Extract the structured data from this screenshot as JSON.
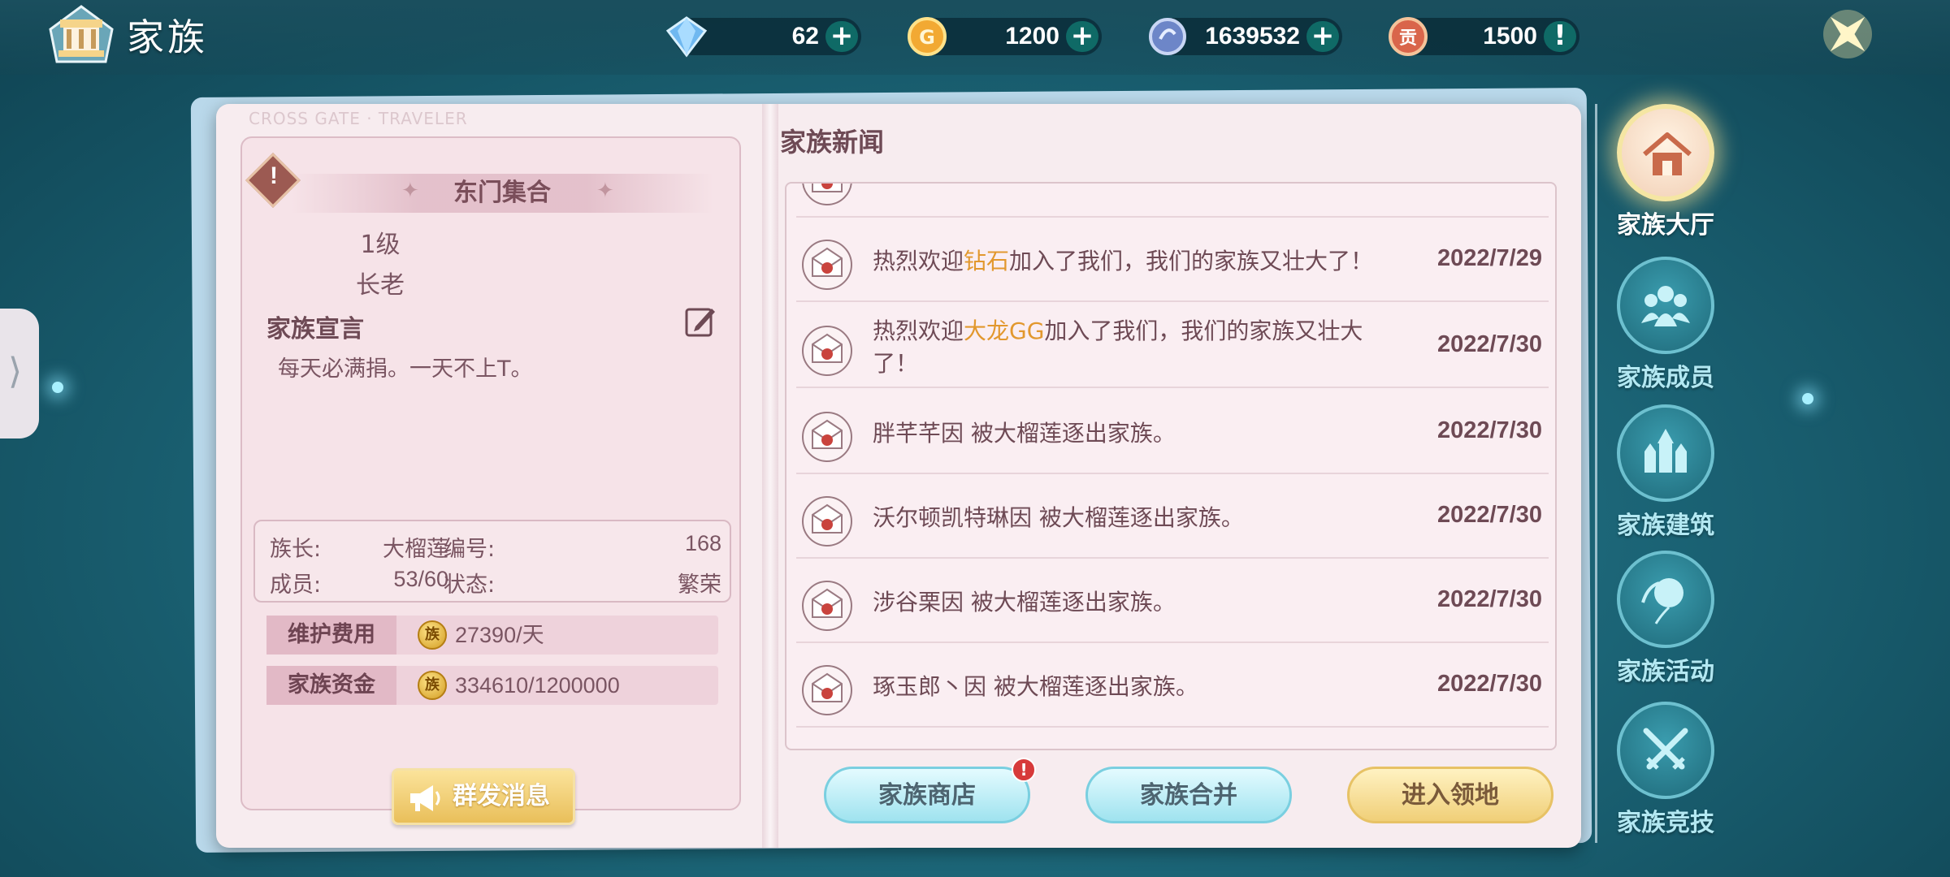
{
  "header": {
    "title": "家族",
    "resources": [
      {
        "icon": "diamond-icon",
        "value": "62",
        "action": "+"
      },
      {
        "icon": "gold-coin-icon",
        "value": "1200",
        "action": "+"
      },
      {
        "icon": "silver-coin-icon",
        "value": "1639532",
        "action": "+"
      },
      {
        "icon": "contribution-icon",
        "value": "1500",
        "action": "!",
        "icon_text": "贡"
      }
    ]
  },
  "left_tab_arrow": "⟩",
  "watermark": "CROSS GATE · TRAVELER",
  "family": {
    "name": "东门集合",
    "level": "1级",
    "role": "长老",
    "declaration_label": "家族宣言",
    "declaration": "每天必满捐。一天不上T。",
    "info": {
      "leader_label": "族长:",
      "leader": "大榴莲",
      "id_label": "编号:",
      "id": "168",
      "members_label": "成员:",
      "members": "53/60",
      "status_label": "状态:",
      "status": "繁荣"
    },
    "maintenance_label": "维护费用",
    "maintenance": "27390/天",
    "funds_label": "家族资金",
    "funds": "334610/1200000",
    "coin_glyph": "族",
    "broadcast_label": "群发消息"
  },
  "news": {
    "title": "家族新闻",
    "items": [
      {
        "prefix": "热烈欢迎",
        "name": "钻石",
        "suffix": "加入了我们，我们的家族又壮大了！",
        "date": "2022/7/29"
      },
      {
        "prefix": "热烈欢迎",
        "name": "大龙GG",
        "suffix": "加入了我们，我们的家族又壮大了！",
        "date": "2022/7/30"
      },
      {
        "text": "胖芊芊因 被大榴莲逐出家族。",
        "date": "2022/7/30"
      },
      {
        "text": "沃尔顿凯特琳因 被大榴莲逐出家族。",
        "date": "2022/7/30"
      },
      {
        "text": "涉谷栗因 被大榴莲逐出家族。",
        "date": "2022/7/30"
      },
      {
        "text": "琢玉郎丶因 被大榴莲逐出家族。",
        "date": "2022/7/30"
      }
    ]
  },
  "buttons": {
    "shop": "家族商店",
    "shop_badge": "!",
    "merge": "家族合并",
    "enter": "进入领地"
  },
  "nav": [
    {
      "label": "家族大厅",
      "icon": "house-icon",
      "active": true
    },
    {
      "label": "家族成员",
      "icon": "members-icon",
      "active": false
    },
    {
      "label": "家族建筑",
      "icon": "castle-icon",
      "active": false
    },
    {
      "label": "家族活动",
      "icon": "balloon-icon",
      "active": false
    },
    {
      "label": "家族竞技",
      "icon": "crossed-swords-icon",
      "active": false
    }
  ],
  "colors": {
    "highlight_name": "#e2982e",
    "text": "#6e4a55",
    "nav_active_glow": "#f5e6a3"
  }
}
